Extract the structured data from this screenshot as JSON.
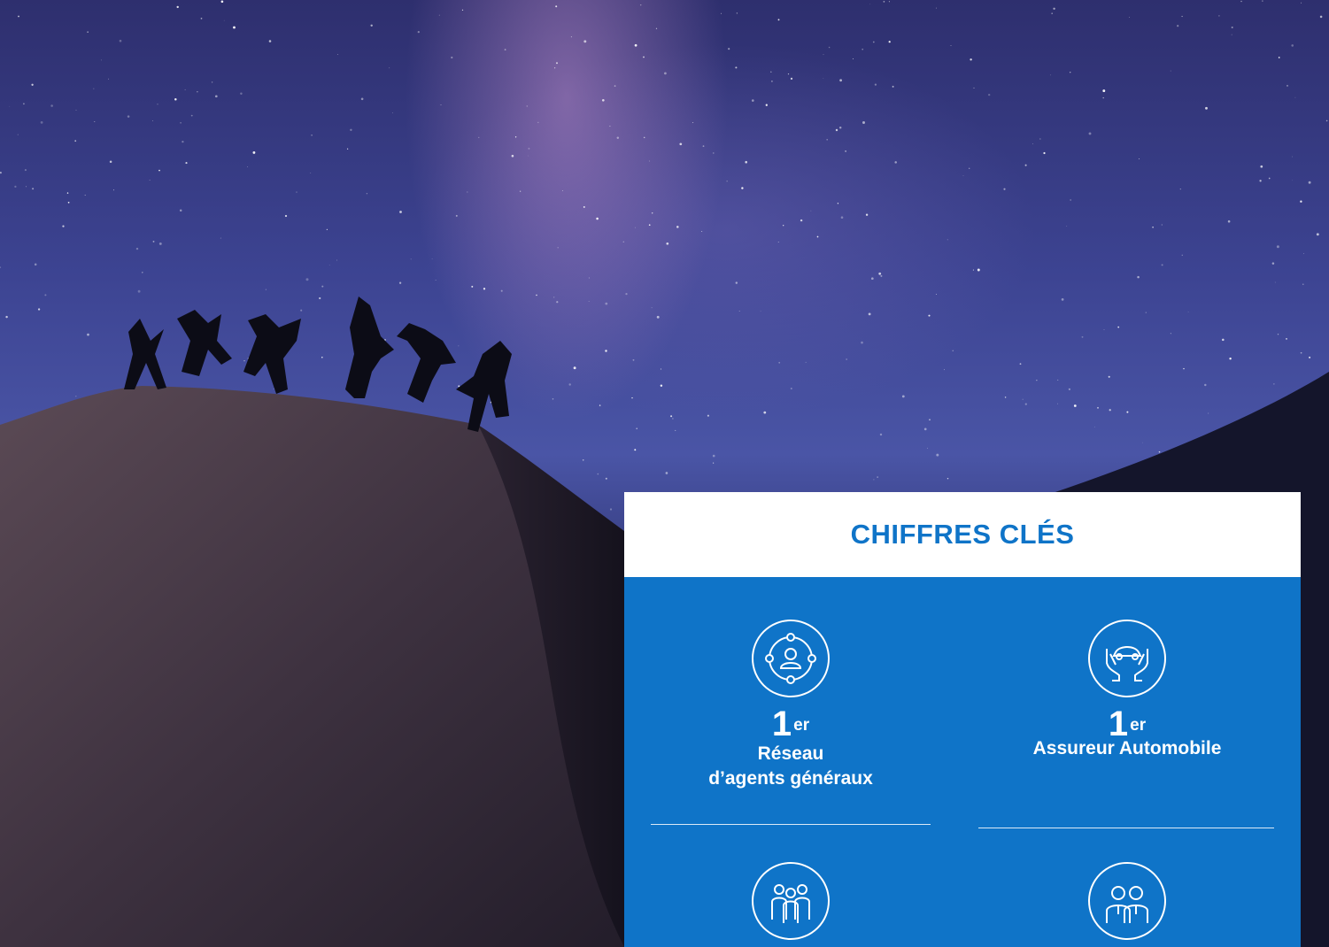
{
  "card": {
    "title": "CHIFFRES CLÉS",
    "stats": [
      {
        "icon": "network-people-icon",
        "rank": "1",
        "rank_suffix": "er",
        "label_line1": "Réseau",
        "label_line2": "d’agents généraux"
      },
      {
        "icon": "hands-car-icon",
        "rank": "1",
        "rank_suffix": "er",
        "label_line1": "Assureur Automobile",
        "label_line2": ""
      },
      {
        "icon": "team-group-icon"
      },
      {
        "icon": "two-people-icon"
      }
    ]
  },
  "colors": {
    "brand_blue": "#0f74c8",
    "card_header_bg": "#ffffff"
  }
}
